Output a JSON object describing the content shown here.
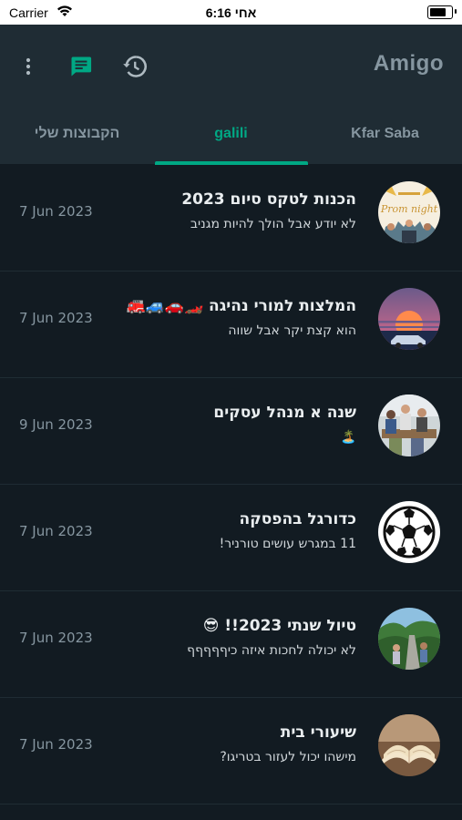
{
  "status_bar": {
    "carrier": "Carrier",
    "time": "6:16 אחי",
    "battery_level": 0.9
  },
  "header": {
    "title": "Amigo",
    "icons": [
      "more-vert-icon",
      "chat-icon",
      "history-icon"
    ],
    "accent": "#00a884"
  },
  "tabs": [
    {
      "label": "הקבוצות שלי",
      "active": false
    },
    {
      "label": "galili",
      "active": true
    },
    {
      "label": "Kfar Saba",
      "active": false
    }
  ],
  "chats": [
    {
      "name": "הכנות לטקס סיום 2023",
      "preview": "לא יודע אבל הולך להיות מגניב",
      "date": "7 Jun 2023"
    },
    {
      "name": "המלצות למורי נהיגה 🏎️🚗🚙🚒",
      "preview": "הוא קצת יקר אבל שווה",
      "date": "7 Jun 2023"
    },
    {
      "name": "שנה א מנהל עסקים",
      "preview": "🏝️",
      "date": "9 Jun 2023"
    },
    {
      "name": "כדורגל בהפסקה",
      "preview": "11 במגרש עושים טורניר!",
      "date": "7 Jun 2023"
    },
    {
      "name": "טיול שנתי 2023!! 😎",
      "preview": "לא יכולה לחכות איזה כיףףףףף",
      "date": "7 Jun 2023"
    },
    {
      "name": "שיעורי בית",
      "preview": "מישהו יכול לעזור בטריגו?",
      "date": "7 Jun 2023"
    }
  ]
}
